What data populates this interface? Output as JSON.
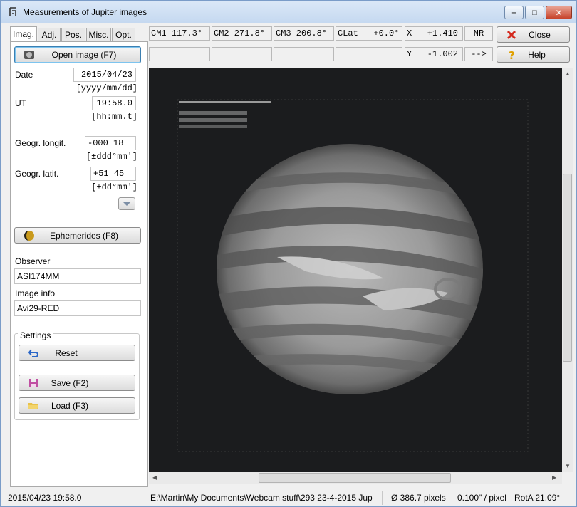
{
  "window": {
    "title": "Measurements of Jupiter images"
  },
  "tabs": [
    "Imag.",
    "Adj.",
    "Pos.",
    "Misc.",
    "Opt."
  ],
  "left": {
    "open_image": "Open image (F7)",
    "date_label": "Date",
    "date_value": "2015/04/23",
    "date_hint": "[yyyy/mm/dd]",
    "ut_label": "UT",
    "ut_value": "19:58.0",
    "ut_hint": "[hh:mm.t]",
    "longit_label": "Geogr. longit.",
    "longit_value": "-000 18",
    "longit_hint": "[±ddd°mm']",
    "latit_label": "Geogr. latit.",
    "latit_value": "+51 45",
    "latit_hint": "[±dd°mm']",
    "ephemerides": "Ephemerides (F8)",
    "observer_label": "Observer",
    "observer_value": "ASI174MM",
    "imageinfo_label": "Image info",
    "imageinfo_value": "Avi29-RED",
    "settings_label": "Settings",
    "reset": "Reset",
    "save": "Save (F2)",
    "load": "Load (F3)"
  },
  "readouts": {
    "cm1": "CM1 117.3°",
    "cm2": "CM2 271.8°",
    "cm3": "CM3 200.8°",
    "clat": "CLat   +0.0°",
    "x": "X   +1.410",
    "nr": "NR",
    "y": "Y   -1.002",
    "arrow": "-->"
  },
  "buttons": {
    "close": "Close",
    "help": "Help"
  },
  "status": {
    "datetime": "2015/04/23   19:58.0",
    "path": "E:\\Martin\\My Documents\\Webcam stuff\\293 23-4-2015 Jup",
    "diameter": "Ø 386.7 pixels",
    "scale": "0.100\" / pixel",
    "rota": "RotA 21.09°"
  },
  "colors": {
    "accent": "#3c7fb1",
    "close_icon": "#d42a1e",
    "help_icon": "#e0a000"
  }
}
